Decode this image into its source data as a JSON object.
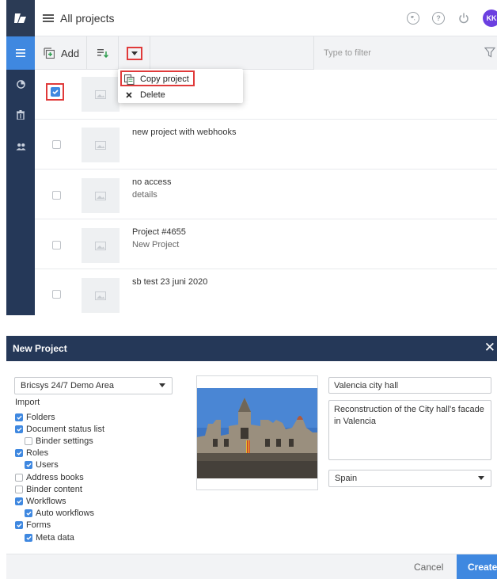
{
  "app": {
    "title": "All projects",
    "avatar_initials": "KK",
    "toolbar": {
      "add_label": "Add",
      "filter_placeholder": "Type to filter"
    },
    "menu": {
      "items": [
        {
          "label": "Copy project",
          "icon": "copy-icon"
        },
        {
          "label": "Delete",
          "icon": "close-icon"
        }
      ]
    },
    "projects": [
      {
        "name": "",
        "description": "",
        "checked": true
      },
      {
        "name": "new project with webhooks",
        "description": "",
        "checked": false
      },
      {
        "name": "no access",
        "description": "details",
        "checked": false
      },
      {
        "name": "Project #4655",
        "description": "New Project",
        "checked": false
      },
      {
        "name": "sb test 23 juni 2020",
        "description": "",
        "checked": false
      }
    ],
    "sidebar_icons": [
      "menu-icon",
      "dashboard-icon",
      "trash-icon",
      "users-icon"
    ],
    "header_icons": [
      "globe-icon",
      "help-icon",
      "power-icon"
    ]
  },
  "dialog": {
    "title": "New Project",
    "template_select": "Bricsys 24/7 Demo Area",
    "import_label": "Import",
    "import_options": [
      {
        "label": "Folders",
        "checked": true,
        "indent": 0
      },
      {
        "label": "Document status list",
        "checked": true,
        "indent": 0
      },
      {
        "label": "Binder settings",
        "checked": false,
        "indent": 1
      },
      {
        "label": "Roles",
        "checked": true,
        "indent": 0
      },
      {
        "label": "Users",
        "checked": true,
        "indent": 1
      },
      {
        "label": "Address books",
        "checked": false,
        "indent": 0
      },
      {
        "label": "Binder content",
        "checked": false,
        "indent": 0
      },
      {
        "label": "Workflows",
        "checked": true,
        "indent": 0
      },
      {
        "label": "Auto workflows",
        "checked": true,
        "indent": 1
      },
      {
        "label": "Forms",
        "checked": true,
        "indent": 0
      },
      {
        "label": "Meta data",
        "checked": true,
        "indent": 1
      }
    ],
    "project_name": "Valencia city hall",
    "project_description": "Reconstruction of the City hall's facade in Valencia",
    "country": "Spain",
    "cancel_label": "Cancel",
    "create_label": "Create"
  },
  "colors": {
    "accent": "#3f88e0",
    "navy": "#253858",
    "highlight": "#e03a3a",
    "avatar": "#6b3fe0"
  }
}
